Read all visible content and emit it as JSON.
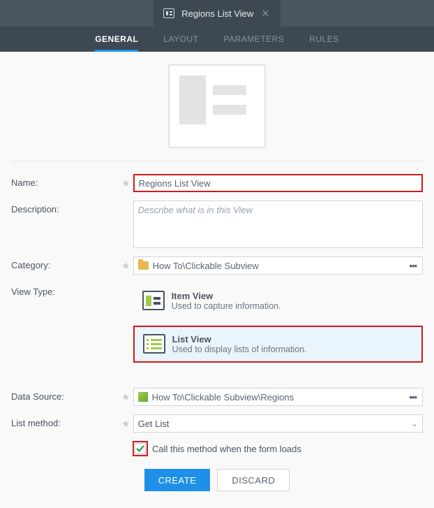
{
  "header": {
    "title": "Regions List View"
  },
  "tabs": {
    "general": "GENERAL",
    "layout": "LAYOUT",
    "parameters": "PARAMETERS",
    "rules": "RULES"
  },
  "labels": {
    "name": "Name:",
    "description": "Description:",
    "category": "Category:",
    "view_type": "View Type:",
    "data_source": "Data Source:",
    "list_method": "List method:"
  },
  "fields": {
    "name_value": "Regions List View",
    "description_placeholder": "Describe what is in this View",
    "category_value": "How To\\Clickable Subview",
    "data_source_value": "How To\\Clickable Subview\\Regions",
    "list_method_value": "Get List",
    "call_method_label": "Call this method when the form loads"
  },
  "view_types": {
    "item": {
      "title": "Item View",
      "desc": "Used to capture information."
    },
    "list": {
      "title": "List View",
      "desc": "Used to display lists of information."
    }
  },
  "buttons": {
    "create": "CREATE",
    "discard": "DISCARD"
  }
}
